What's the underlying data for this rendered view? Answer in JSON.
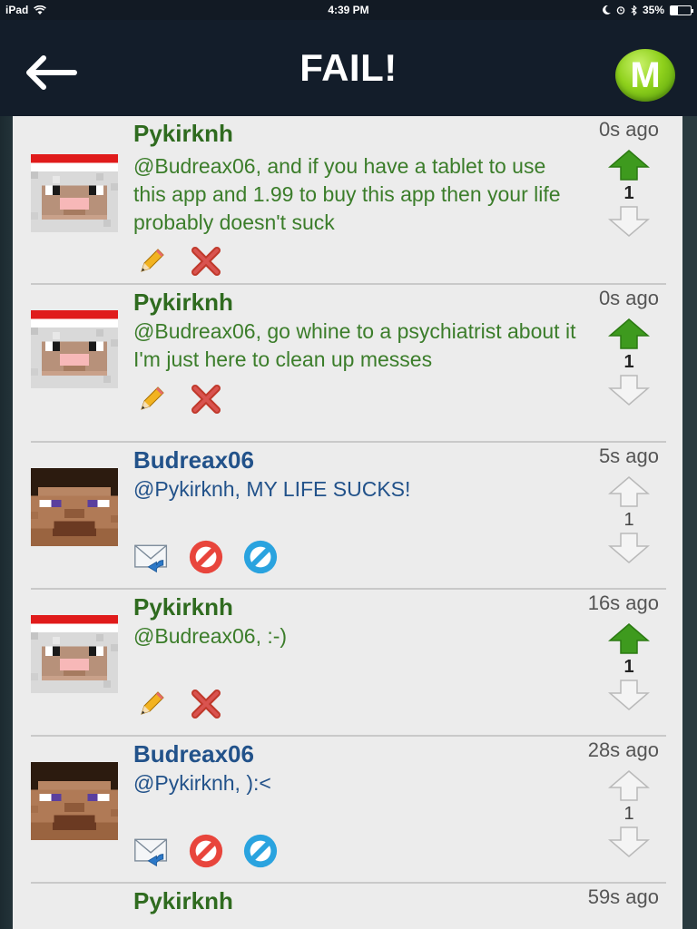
{
  "status": {
    "device": "iPad",
    "time": "4:39 PM",
    "battery": "35%",
    "battery_fraction": 0.35
  },
  "nav": {
    "title": "FAIL!",
    "back_icon": "back-arrow-icon",
    "menu_label": "M"
  },
  "colors": {
    "own_name": "#2f6b1f",
    "own_text": "#3b7d2a",
    "other_text": "#22528a",
    "upvote_active": "#3e9a1e"
  },
  "comments": [
    {
      "user": "Pykirknh",
      "text": "@Budreax06, and if you have a tablet to use this app and 1.99 to buy this app then your life probably doesn't suck",
      "time": "0s ago",
      "votes": "1",
      "upvoted": true,
      "own": true
    },
    {
      "user": "Pykirknh",
      "text": "@Budreax06, go whine to a psychiatrist about it I'm just here to clean up messes",
      "time": "0s ago",
      "votes": "1",
      "upvoted": true,
      "own": true
    },
    {
      "user": "Budreax06",
      "text": "@Pykirknh, MY LIFE SUCKS!",
      "time": "5s ago",
      "votes": "1",
      "upvoted": false,
      "own": false
    },
    {
      "user": "Pykirknh",
      "text": "@Budreax06, :-)",
      "time": "16s ago",
      "votes": "1",
      "upvoted": true,
      "own": true
    },
    {
      "user": "Budreax06",
      "text": "@Pykirknh, ):<",
      "time": "28s ago",
      "votes": "1",
      "upvoted": false,
      "own": false
    },
    {
      "user": "Pykirknh",
      "text": "",
      "time": "59s ago",
      "votes": "",
      "upvoted": false,
      "own": true
    }
  ]
}
